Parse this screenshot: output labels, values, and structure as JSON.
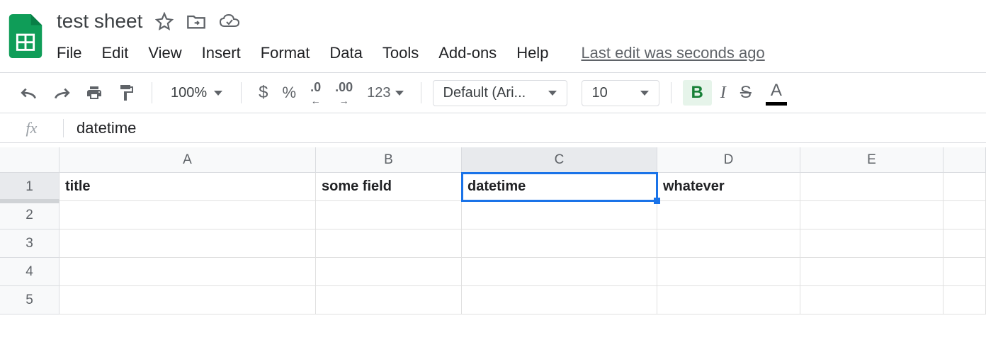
{
  "document": {
    "title": "test sheet"
  },
  "menu": {
    "items": [
      "File",
      "Edit",
      "View",
      "Insert",
      "Format",
      "Data",
      "Tools",
      "Add-ons",
      "Help"
    ],
    "last_edit": "Last edit was seconds ago"
  },
  "toolbar": {
    "zoom": "100%",
    "currency": "$",
    "percent": "%",
    "dec_dec": ".0",
    "inc_dec": ".00",
    "more_formats": "123",
    "font_name": "Default (Ari...",
    "font_size": "10",
    "bold": "B",
    "italic": "I",
    "strike": "S",
    "text_color": "A"
  },
  "formula_bar": {
    "fx": "fx",
    "value": "datetime"
  },
  "grid": {
    "columns": [
      "A",
      "B",
      "C",
      "D",
      "E"
    ],
    "rows": [
      "1",
      "2",
      "3",
      "4",
      "5"
    ],
    "selected_column": "C",
    "selected_row": "1",
    "cells": {
      "r1": {
        "A": "title",
        "B": "some field",
        "C": "datetime",
        "D": "whatever",
        "E": ""
      }
    }
  }
}
